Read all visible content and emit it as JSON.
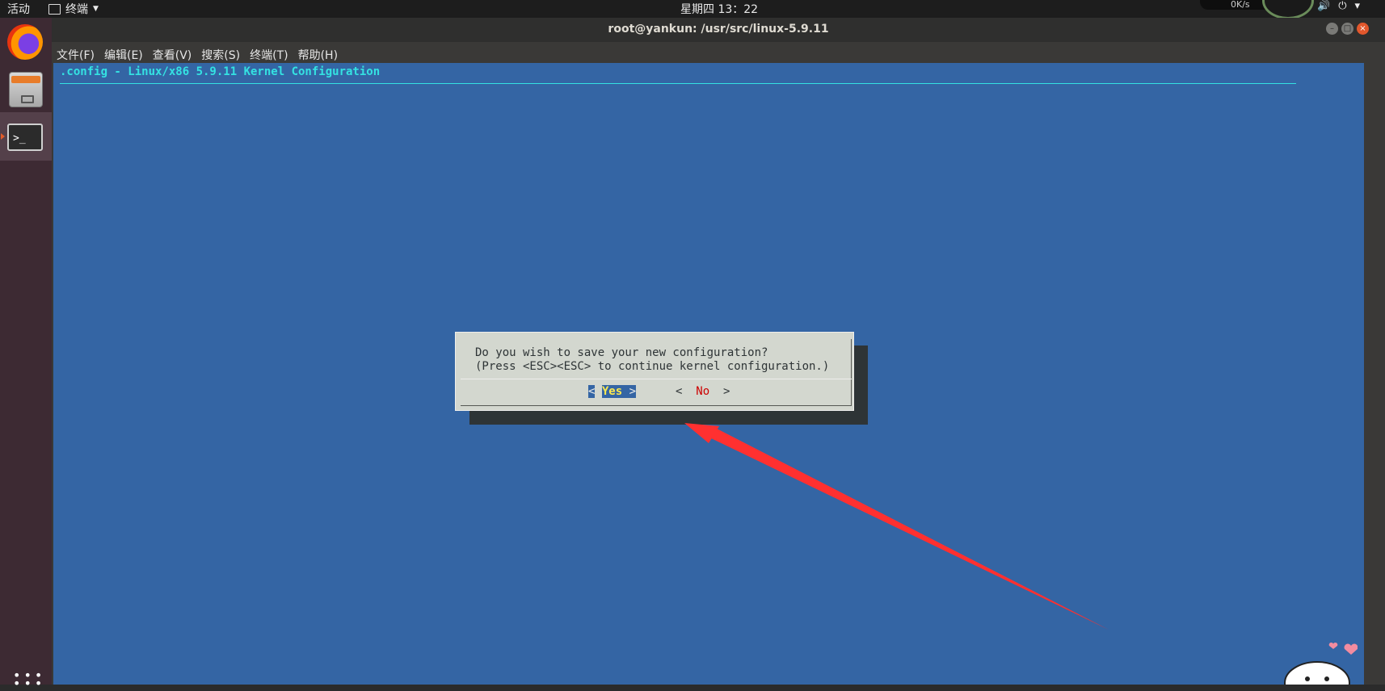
{
  "topbar": {
    "activities": "活动",
    "app_name": "终端",
    "clock": "星期四 13：22",
    "net_speed": "0K/s"
  },
  "dock": {
    "items": [
      "firefox-icon",
      "files-icon",
      "terminal-icon"
    ]
  },
  "window": {
    "title": "root@yankun: /usr/src/linux-5.9.11",
    "menus": [
      "文件(F)",
      "编辑(E)",
      "查看(V)",
      "搜索(S)",
      "终端(T)",
      "帮助(H)"
    ]
  },
  "terminal": {
    "header": ".config - Linux/x86 5.9.11 Kernel Configuration",
    "dialog": {
      "line1": "Do you wish to save your new configuration?",
      "line2": "(Press <ESC><ESC> to continue kernel configuration.)",
      "yes_label": "Yes",
      "no_label": "No"
    }
  },
  "colors": {
    "terminal_bg": "#3465a4",
    "header_fg": "#34e2e2",
    "dialog_bg": "#d3d7cf",
    "annotation_arrow": "#ff3030"
  }
}
